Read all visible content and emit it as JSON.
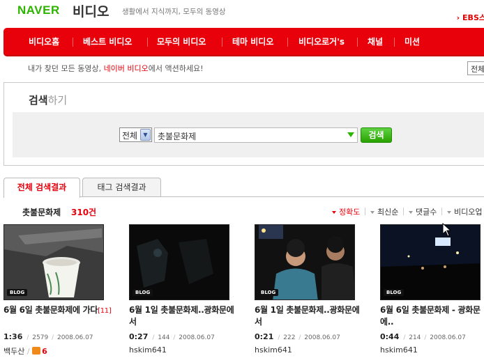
{
  "header": {
    "logo_naver": "NAVER",
    "logo_video": "비디오",
    "tagline": "생활에서 지식까지, 모두의 동영상",
    "ebs_link": "EBS스"
  },
  "nav": {
    "items": [
      "비디오홈",
      "베스트 비디오",
      "모두의 비디오",
      "테마 비디오",
      "비디오로거's",
      "채널",
      "미션"
    ]
  },
  "intro": {
    "before": "내가 찾던 모든 동영상, ",
    "highlight": "네이버 비디오",
    "after": "에서 액션하세요!",
    "box_value": "전체"
  },
  "search": {
    "title_bold": "검색",
    "title_light": "하기",
    "scope_value": "전체",
    "query_value": "촛불문화제",
    "button_label": "검색"
  },
  "tabs": {
    "all_results": "전체 검색결과",
    "tag_results": "태그 검색결과"
  },
  "results": {
    "query": "촛불문화제",
    "count": "310건",
    "sort_options": [
      "정확도",
      "최신순",
      "댓글수",
      "비디오업"
    ]
  },
  "videos": [
    {
      "badge": "BLOG",
      "title": "6월 6일 촛불문화제에 가다",
      "comment_count": "[11]",
      "duration": "1:36",
      "views": "2579",
      "date": "2008.06.07",
      "author": "백두산",
      "likes": "6"
    },
    {
      "badge": "BLOG",
      "title": "6월 1일 촛불문화제..광화문에서",
      "comment_count": "",
      "duration": "0:27",
      "views": "144",
      "date": "2008.06.07",
      "author": "hskim641",
      "likes": ""
    },
    {
      "badge": "BLOG",
      "title": "6월 1일 촛불문화제..광화문에서",
      "comment_count": "",
      "duration": "0:21",
      "views": "222",
      "date": "2008.06.07",
      "author": "hskim641",
      "likes": ""
    },
    {
      "badge": "BLOG",
      "title": "6월 6일 촛불문화제 - 광화문에..",
      "comment_count": "",
      "duration": "0:44",
      "views": "214",
      "date": "2008.06.07",
      "author": "hskim641",
      "likes": ""
    }
  ],
  "colors": {
    "brand_green": "#2db400",
    "nav_red": "#e8000b"
  }
}
